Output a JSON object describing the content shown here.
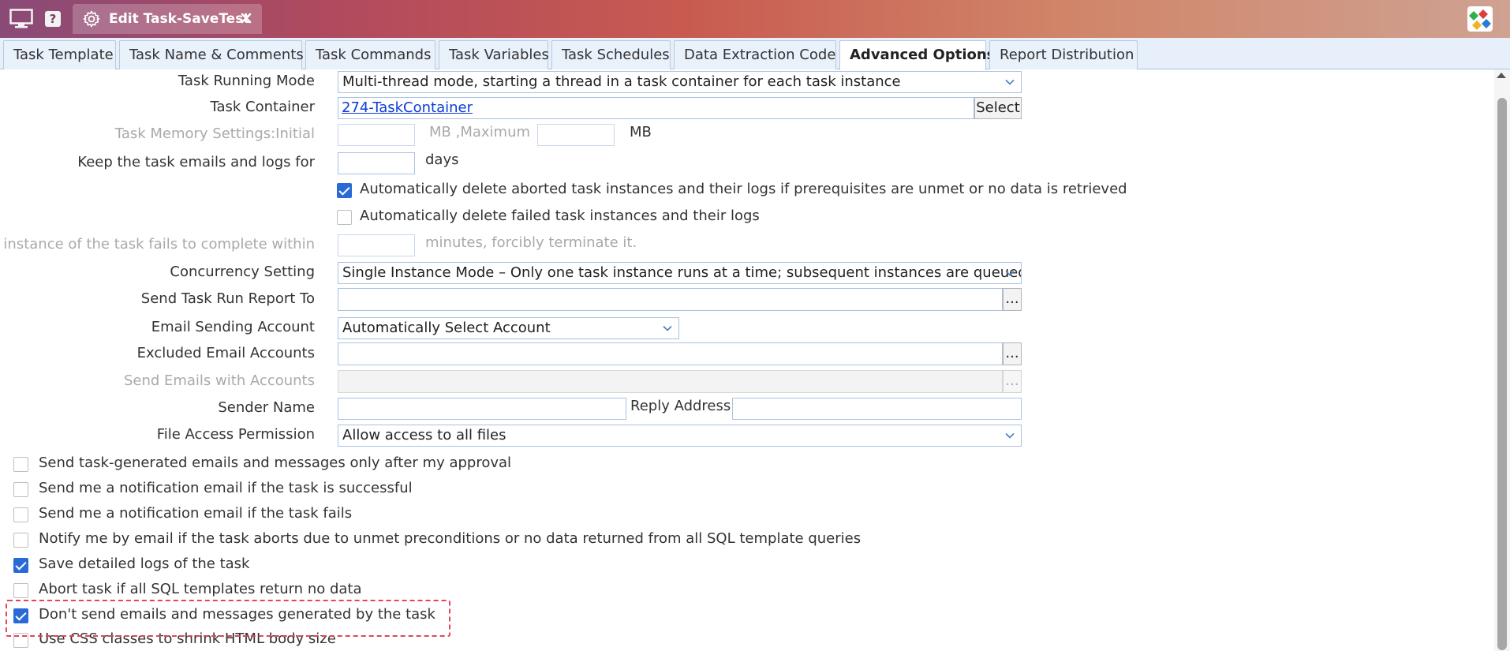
{
  "window": {
    "tab_title": "Edit Task-SaveTest",
    "help_label": "?"
  },
  "tabs": [
    {
      "label": "Task Template",
      "active": false
    },
    {
      "label": "Task Name & Comments",
      "active": false
    },
    {
      "label": "Task Commands",
      "active": false
    },
    {
      "label": "Task Variables",
      "active": false
    },
    {
      "label": "Task Schedules",
      "active": false
    },
    {
      "label": "Data Extraction Code",
      "active": false
    },
    {
      "label": "Advanced Options",
      "active": true
    },
    {
      "label": "Report Distribution",
      "active": false
    }
  ],
  "form": {
    "running_mode": {
      "label": "Task Running Mode",
      "value": "Multi-thread mode, starting a thread in a task container for each task instance"
    },
    "container": {
      "label": "Task Container",
      "value": "274-TaskContainer",
      "button": "Select"
    },
    "memory": {
      "label": "Task Memory Settings:Initial",
      "unit1": "MB ,Maximum",
      "unit2": "MB"
    },
    "keep": {
      "label": "Keep the task emails and logs for",
      "unit": "days"
    },
    "auto_delete_aborted": {
      "label": "Automatically delete aborted task instances and their logs if prerequisites are unmet or no data is retrieved",
      "checked": true
    },
    "auto_delete_failed": {
      "label": "Automatically delete failed task instances and their logs",
      "checked": false
    },
    "timeout": {
      "label": "If the instance of the task fails to complete within",
      "unit": "minutes, forcibly terminate it."
    },
    "concurrency": {
      "label": "Concurrency Setting",
      "value": "Single Instance Mode – Only one task instance runs at a time; subsequent instances are queued"
    },
    "send_report": {
      "label": "Send Task Run Report To",
      "button": "..."
    },
    "email_account": {
      "label": "Email Sending Account",
      "value": "Automatically Select Account"
    },
    "excluded": {
      "label": "Excluded Email Accounts",
      "button": "..."
    },
    "send_with": {
      "label": "Send Emails with Accounts",
      "button": "..."
    },
    "sender": {
      "label": "Sender Name",
      "reply_label": "Reply Address"
    },
    "file_access": {
      "label": "File Access Permission",
      "value": "Allow access to all files"
    }
  },
  "options": [
    {
      "label": "Send task-generated emails and messages only after my approval",
      "checked": false
    },
    {
      "label": "Send me a notification email if the task is successful",
      "checked": false
    },
    {
      "label": "Send me a notification email if the task fails",
      "checked": false
    },
    {
      "label": "Notify me by email if the task aborts due to unmet preconditions or no data returned from all SQL template queries",
      "checked": false
    },
    {
      "label": "Save detailed logs of the task",
      "checked": true
    },
    {
      "label": "Abort task if all SQL templates return no data",
      "checked": false
    },
    {
      "label": "Don't send emails and messages generated by the task",
      "checked": true
    },
    {
      "label": "Use CSS classes to shrink HTML body size",
      "checked": false
    }
  ],
  "colors": {
    "accent": "#2a6ad6",
    "highlight_border": "#e0455a",
    "link": "#0b3dd6"
  }
}
